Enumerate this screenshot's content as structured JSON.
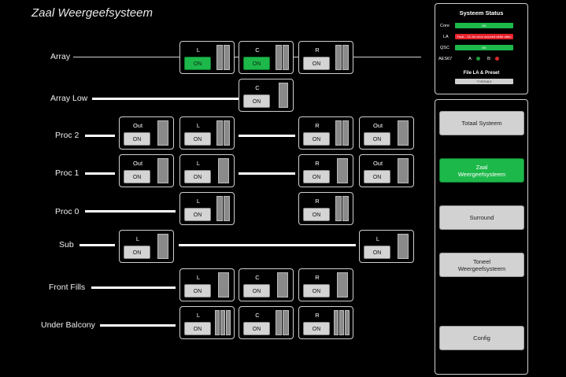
{
  "app": {
    "title": "Zaal Weergeefsysteem"
  },
  "rows": {
    "array": "Array",
    "array_low": "Array Low",
    "proc2": "Proc 2",
    "proc1": "Proc 1",
    "proc0": "Proc 0",
    "sub": "Sub",
    "front_fills": "Front Fills",
    "under_balcony": "Under Balcony"
  },
  "channels": {
    "L": "L",
    "C": "C",
    "R": "R",
    "Out": "Out"
  },
  "buttons": {
    "on": "ON"
  },
  "status": {
    "title": "Systeem Status",
    "core_label": "Core",
    "core_value": "OK",
    "la_label": "LA",
    "la_value": "Fault - 13: An error occured while atten",
    "qsc_label": "QSC",
    "qsc_value": "OK",
    "aes_label": "AES67",
    "aes_a": "A:",
    "aes_b": "B:",
    "file_title": "File LA & Preset",
    "file_value": "*7.ROVA II"
  },
  "colors": {
    "green": "#1db84a",
    "red": "#e8202a",
    "dot_green": "#1e9a3c",
    "dot_red": "#d62828"
  },
  "nav": {
    "totaal": "Totaal Systeem",
    "zaal": "Zaal\nWeergeefsysteem",
    "surround": "Surround",
    "toneel": "Toneel\nWeergeefsysteem",
    "config": "Config"
  }
}
